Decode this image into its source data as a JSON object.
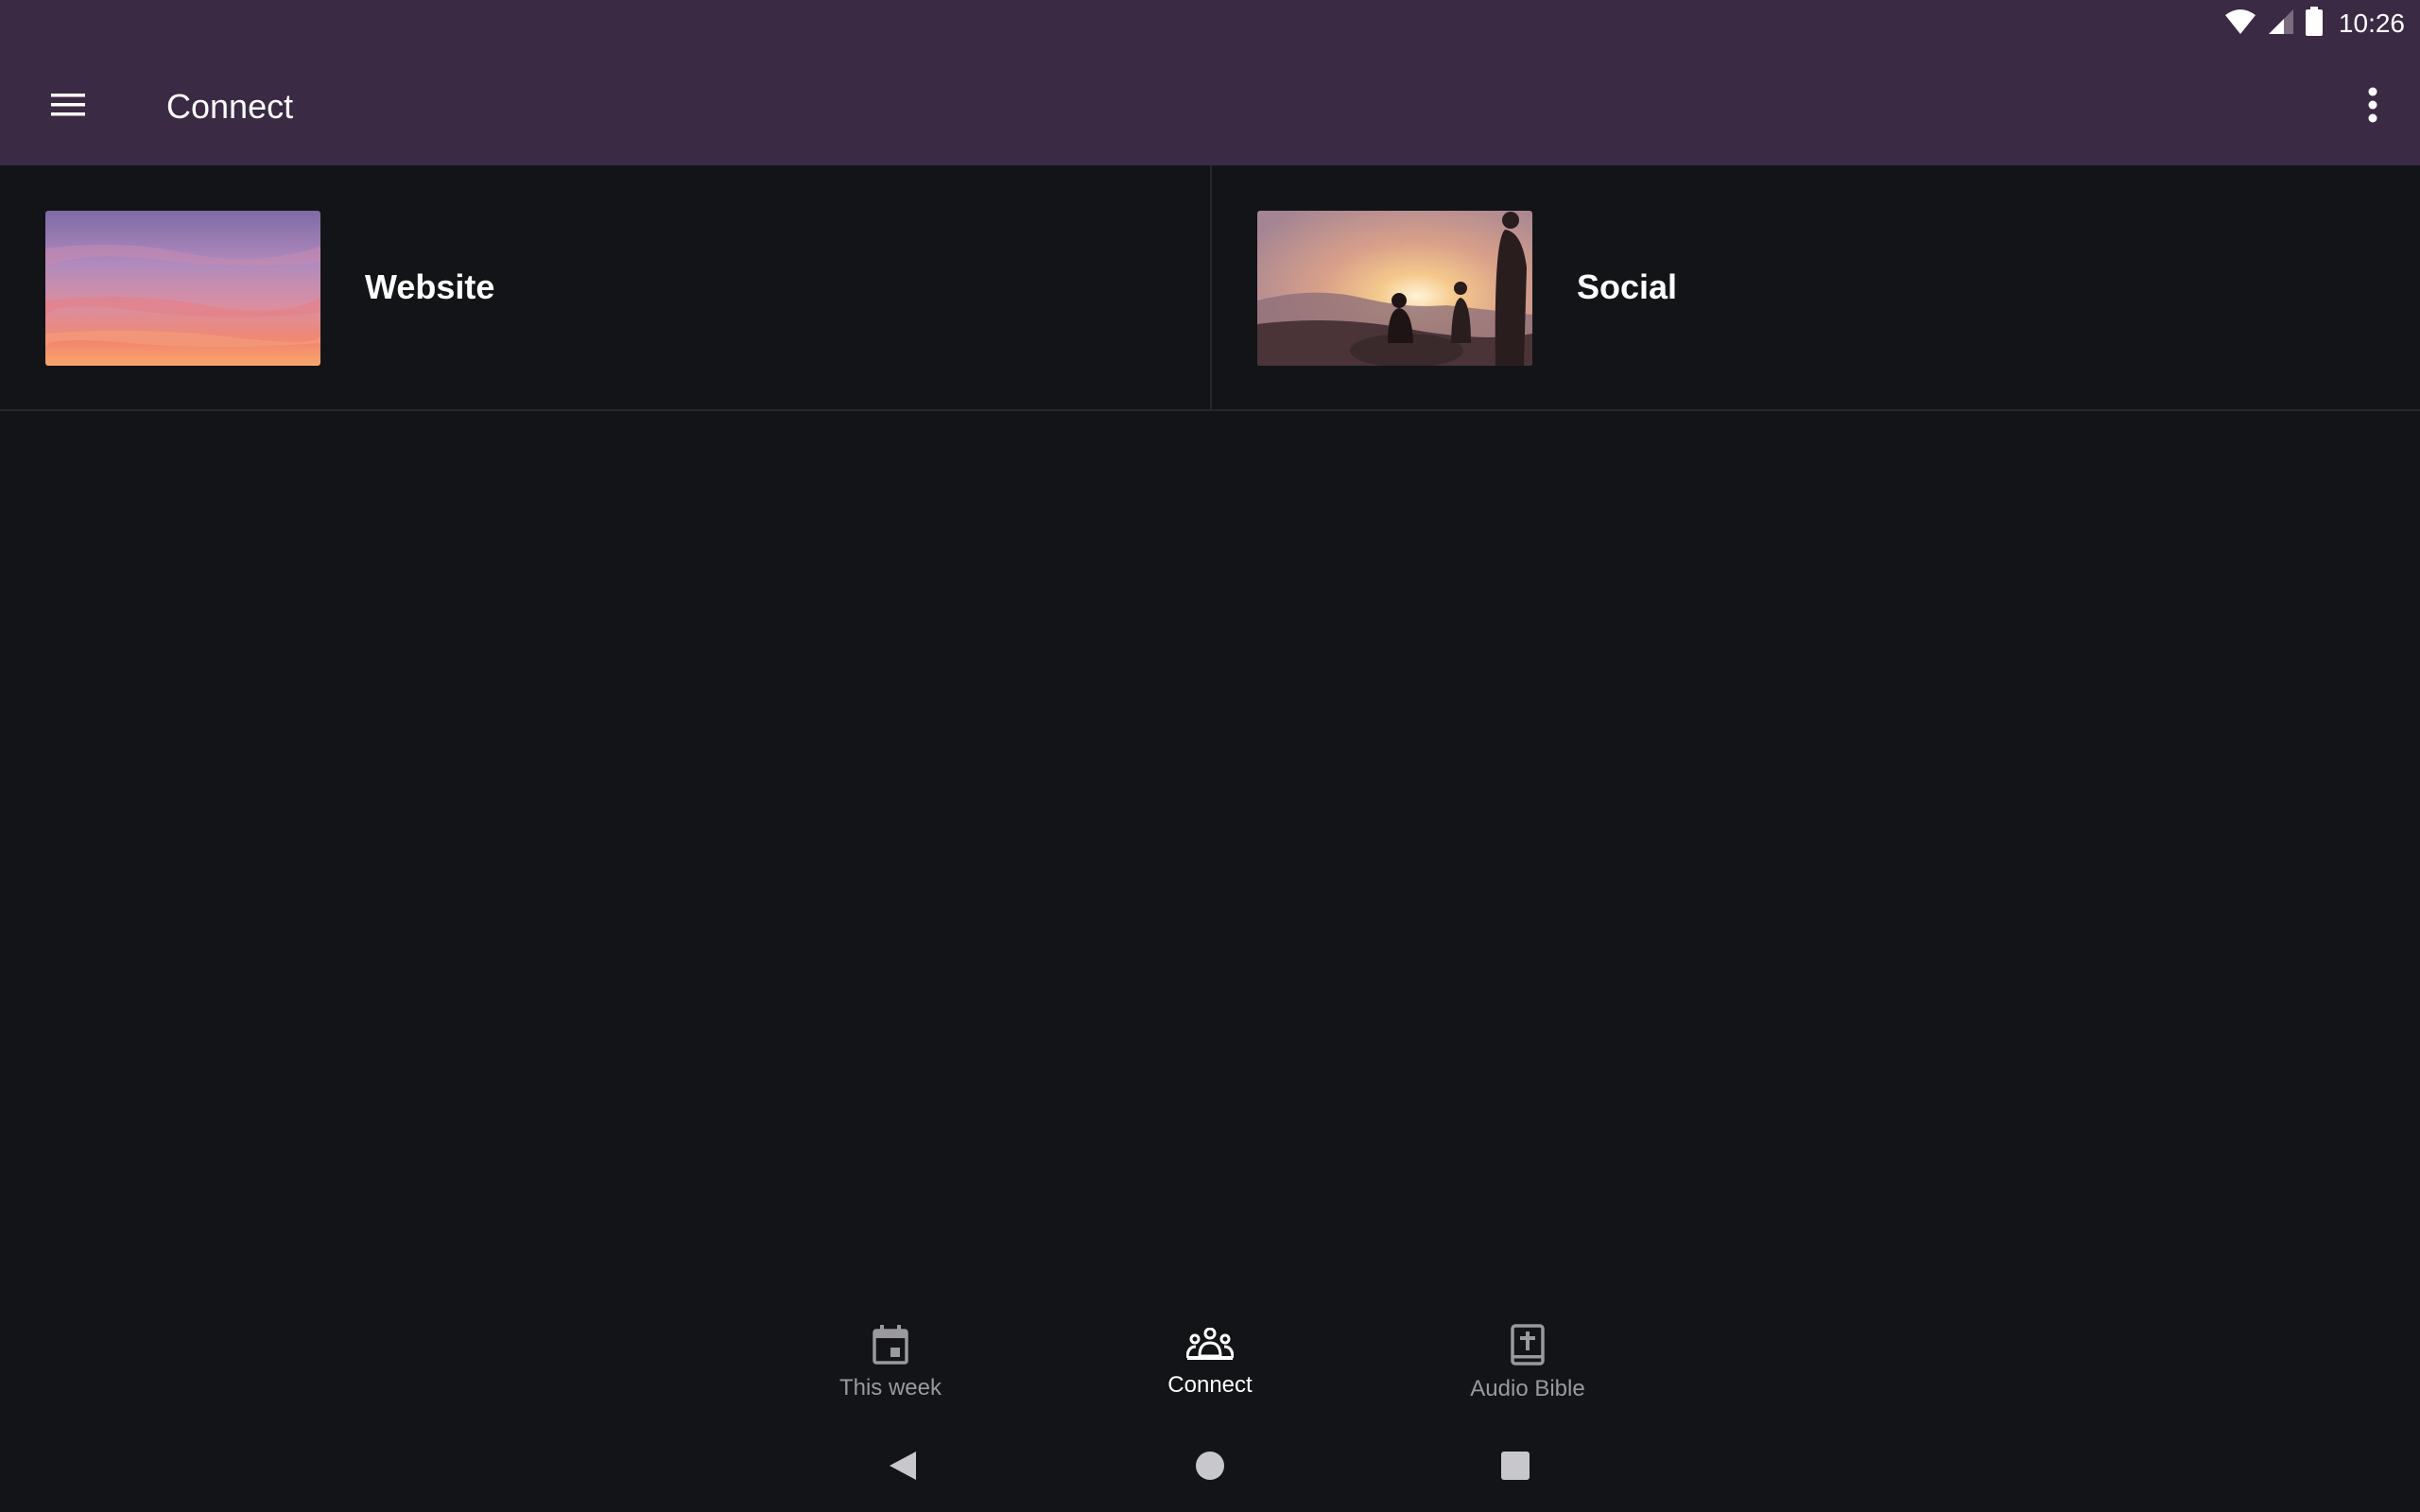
{
  "status_bar": {
    "time": "10:26",
    "icons": [
      "wifi-icon",
      "cell-signal-icon",
      "battery-icon"
    ]
  },
  "app_bar": {
    "title": "Connect",
    "menu_icon": "hamburger-menu-icon",
    "overflow_icon": "more-vert-icon"
  },
  "tiles": [
    {
      "label": "Website",
      "image": "sunset-sky-photo"
    },
    {
      "label": "Social",
      "image": "hikers-at-sunset-photo"
    }
  ],
  "bottom_nav": {
    "items": [
      {
        "label": "This week",
        "icon": "calendar-icon",
        "active": false
      },
      {
        "label": "Connect",
        "icon": "groups-icon",
        "active": true
      },
      {
        "label": "Audio Bible",
        "icon": "bible-icon",
        "active": false
      }
    ]
  },
  "system_nav": {
    "buttons": [
      "back-icon",
      "home-icon",
      "recents-icon"
    ]
  },
  "colors": {
    "app_bar": "#3b2a44",
    "background": "#131417",
    "divider": "#26272b",
    "inactive_text": "#9a9a9e",
    "active_text": "#ffffff"
  }
}
